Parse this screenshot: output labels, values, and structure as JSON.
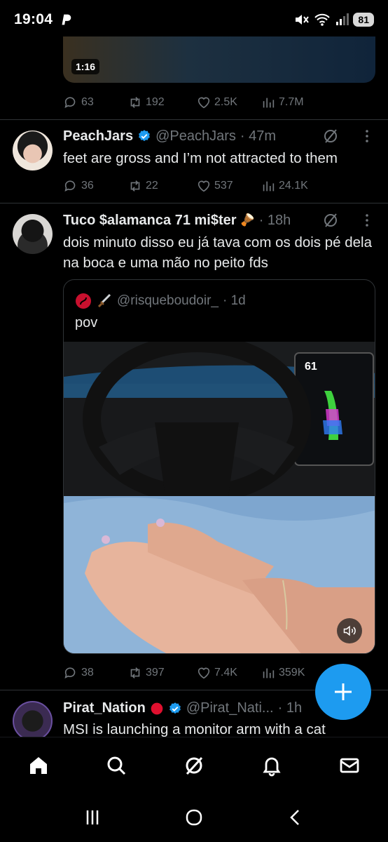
{
  "status_bar": {
    "time": "19:04",
    "battery": "81"
  },
  "tweet_prev": {
    "video_duration": "1:16",
    "replies": "63",
    "reposts": "192",
    "likes": "2.5K",
    "views": "7.7M"
  },
  "tweet_peach": {
    "name": "PeachJars",
    "handle": "@PeachJars",
    "time": "· 47m",
    "text": "feet are gross and I’m not attracted to them",
    "replies": "36",
    "reposts": "22",
    "likes": "537",
    "views": "24.1K"
  },
  "tweet_tuco": {
    "name": "Tuco $alamanca 71 mi$ter",
    "name_emoji": "🪘",
    "time": "· 18h",
    "text": "dois minuto disso eu já tava com os dois pé dela na boca e uma mão no peito fds",
    "quote": {
      "handle": "@risqueboudoir_",
      "time": "· 1d",
      "text": "pov",
      "screen_number": "61"
    },
    "replies": "38",
    "reposts": "397",
    "likes": "7.4K",
    "views": "359K"
  },
  "tweet_pirat": {
    "name": "Pirat_Nation",
    "handle": "@Pirat_Nati...",
    "time": "· 1h",
    "text": "MSI is launching a monitor arm with a cat"
  },
  "fab": {
    "icon": "plus-icon"
  },
  "colors": {
    "accent": "#1d9bf0",
    "muted": "#71767b",
    "divider": "#2f3336"
  }
}
